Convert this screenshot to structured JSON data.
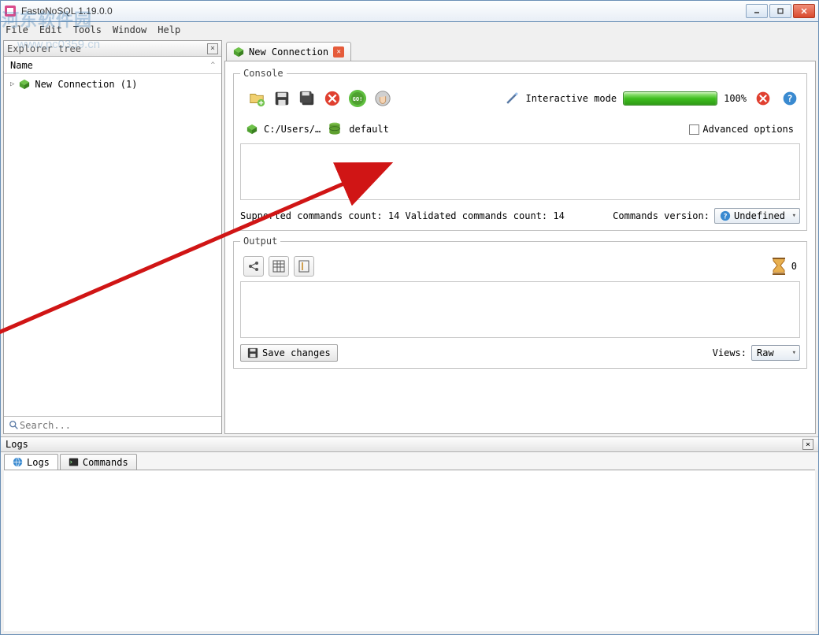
{
  "window": {
    "title": "FastoNoSQL 1.19.0.0"
  },
  "menu": {
    "file": "File",
    "edit": "Edit",
    "tools": "Tools",
    "window": "Window",
    "help": "Help"
  },
  "explorer": {
    "title": "Explorer tree",
    "col_name": "Name",
    "item1": "New Connection (1)",
    "search_placeholder": "Search..."
  },
  "tab": {
    "label": "New Connection"
  },
  "console": {
    "legend": "Console",
    "interactive_label": "Interactive mode",
    "progress_pct": "100%",
    "path": "C:/Users/…",
    "db": "default",
    "advanced": "Advanced options",
    "status": "Supported commands count: 14 Validated commands count: 14",
    "cmd_version_label": "Commands version:",
    "cmd_version_value": "Undefined"
  },
  "output": {
    "legend": "Output",
    "count": "0",
    "save": "Save changes",
    "views_label": "Views:",
    "views_value": "Raw"
  },
  "logs": {
    "title": "Logs",
    "tab_logs": "Logs",
    "tab_cmds": "Commands"
  },
  "watermark": {
    "line1": "河东软件园",
    "line2": "www.pc0359.cn"
  }
}
